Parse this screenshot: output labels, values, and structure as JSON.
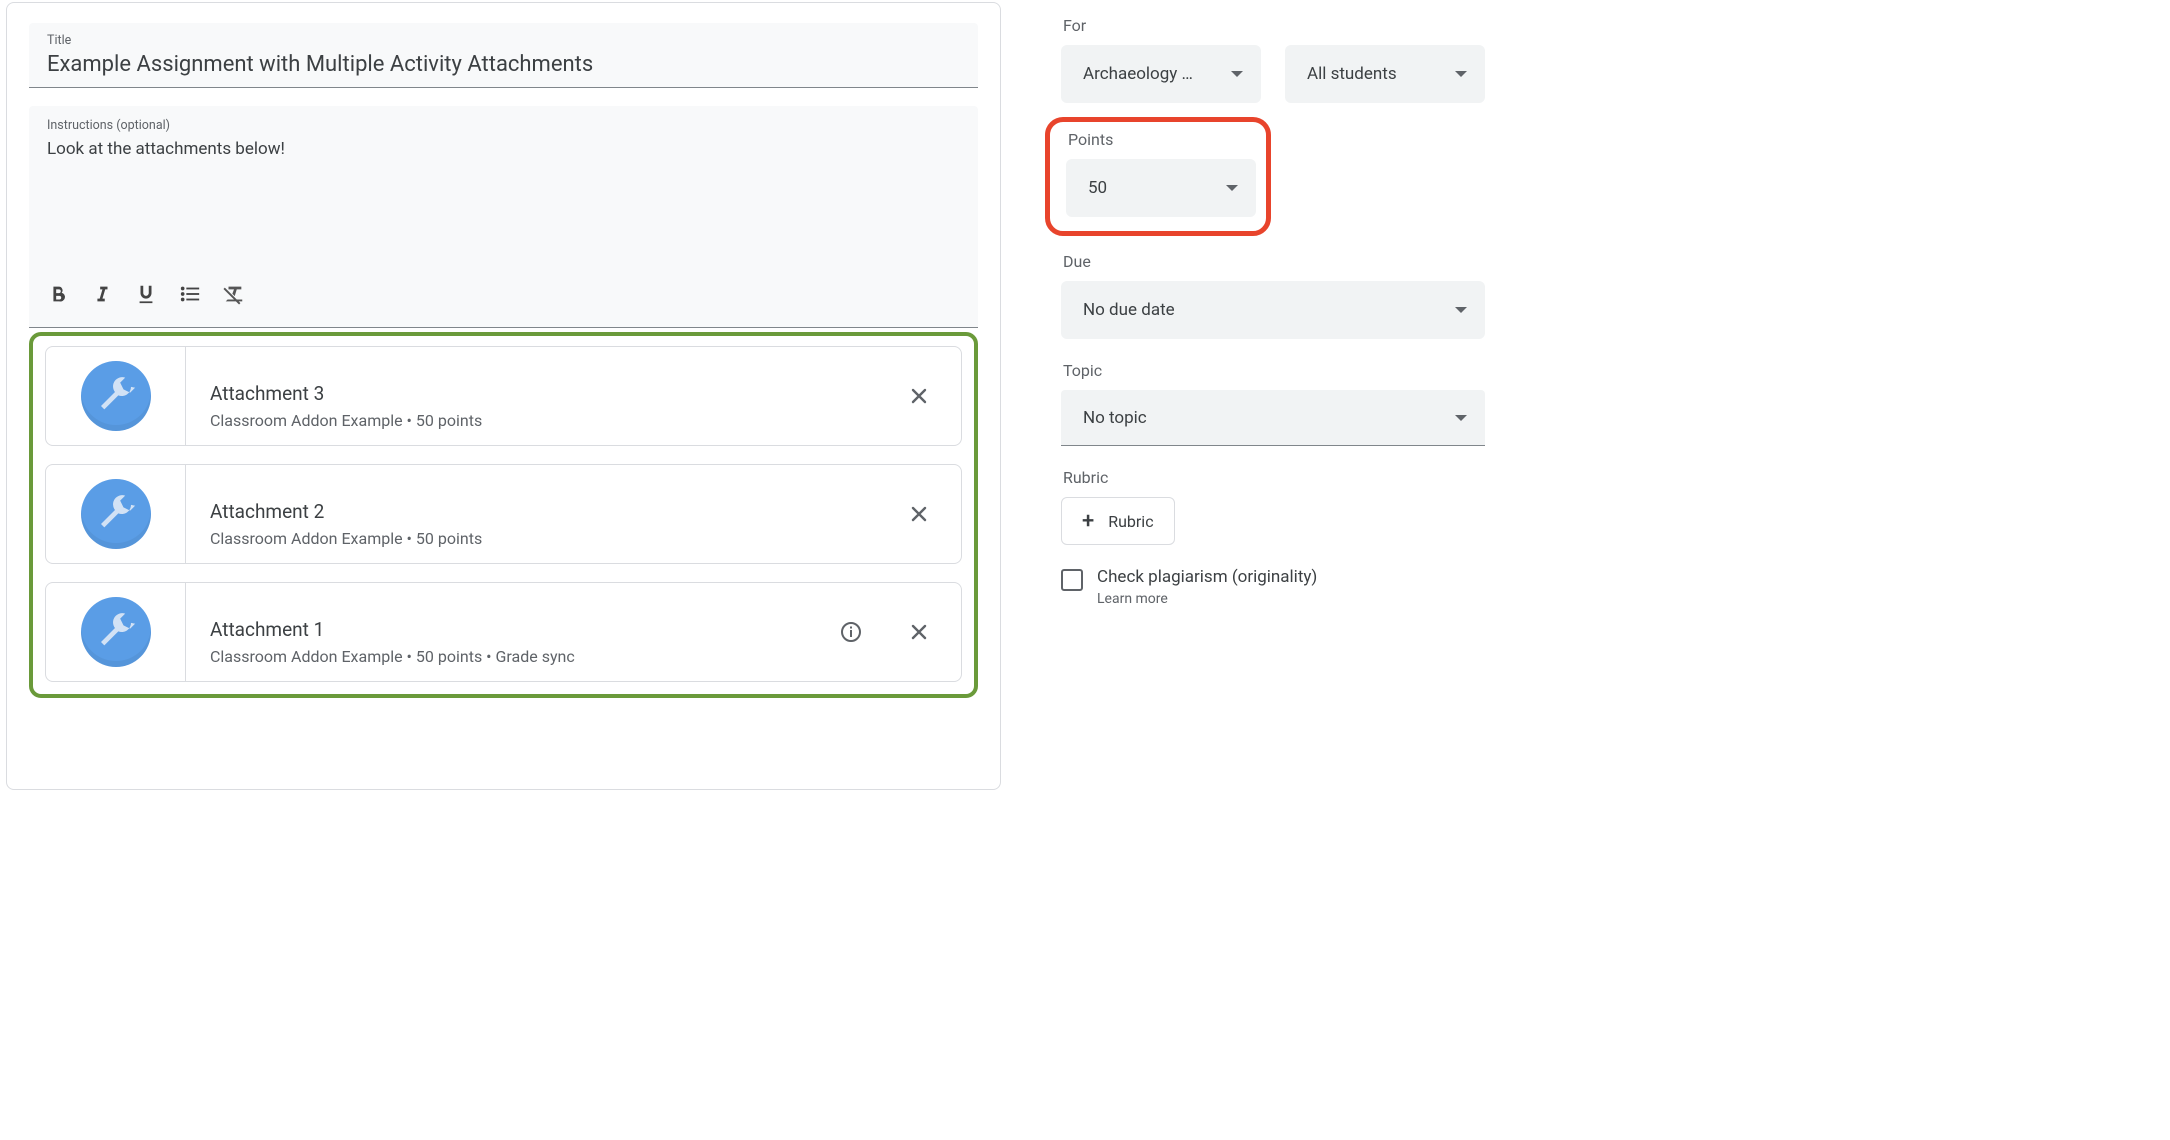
{
  "title_label": "Title",
  "title_value": "Example Assignment with Multiple Activity Attachments",
  "instructions_label": "Instructions (optional)",
  "instructions_value": "Look at the attachments below!",
  "attachments": [
    {
      "title": "Attachment 3",
      "subtitle": "Classroom Addon Example • 50 points",
      "has_info": false
    },
    {
      "title": "Attachment 2",
      "subtitle": "Classroom Addon Example • 50 points",
      "has_info": false
    },
    {
      "title": "Attachment 1",
      "subtitle": "Classroom Addon Example • 50 points • Grade sync",
      "has_info": true
    }
  ],
  "sidebar": {
    "for_label": "For",
    "for_class": "Archaeology …",
    "for_students": "All students",
    "points_label": "Points",
    "points_value": "50",
    "due_label": "Due",
    "due_value": "No due date",
    "topic_label": "Topic",
    "topic_value": "No topic",
    "rubric_label": "Rubric",
    "rubric_button": "Rubric",
    "plagiarism_label": "Check plagiarism (originality)",
    "learn_more": "Learn more"
  }
}
